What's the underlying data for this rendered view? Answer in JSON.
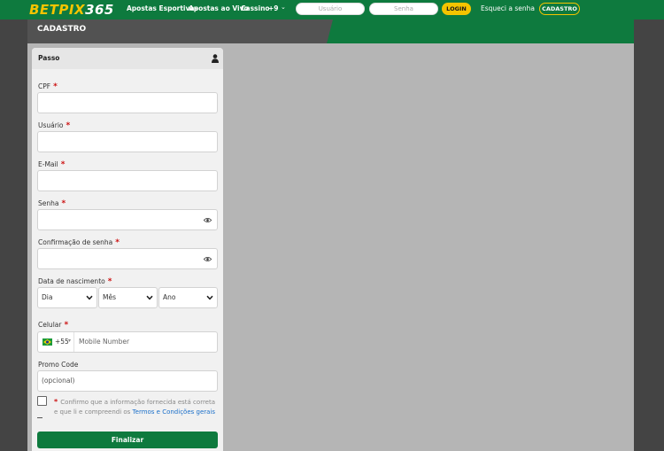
{
  "header": {
    "logo_part1": "BETPIX",
    "logo_part2": "365",
    "nav": [
      "Apostas Esportivas",
      "Apostas ao Vivo",
      "Cassino",
      "+9"
    ],
    "nav_caret": "⌄",
    "username_placeholder": "Usuário",
    "password_placeholder": "Senha",
    "login_label": "LOGIN",
    "forgot_label": "Esqueci a senha",
    "register_label": "CADASTRO"
  },
  "page": {
    "title": "CADASTRO"
  },
  "form": {
    "step_label": "Passo",
    "cpf_label": "CPF",
    "username_label": "Usuário",
    "email_label": "E-Mail",
    "password_label": "Senha",
    "confirm_password_label": "Confirmação de senha",
    "birthdate_label": "Data de nascimento",
    "day_label": "Dia",
    "month_label": "Mês",
    "year_label": "Ano",
    "phone_label": "Celular",
    "phone_code": "+55",
    "phone_caret": "▾",
    "phone_placeholder": "Mobile Number",
    "promo_label": "Promo Code",
    "promo_placeholder": "(opcional)",
    "required_mark": "*",
    "confirm_text": "Confirmo que a informação fornecida está correta e que li e compreendi os",
    "terms_link": "Termos e Condições gerais",
    "submit_label": "Finalizar"
  },
  "colors": {
    "brand_green": "#0e7a3e",
    "brand_yellow": "#f5c400",
    "required_red": "#cc1111",
    "link_blue": "#1a6fc9"
  },
  "icons": {
    "user": "user-icon",
    "eye": "eye-icon",
    "chevron": "chevron-down-icon",
    "flag": "brazil-flag-icon"
  }
}
